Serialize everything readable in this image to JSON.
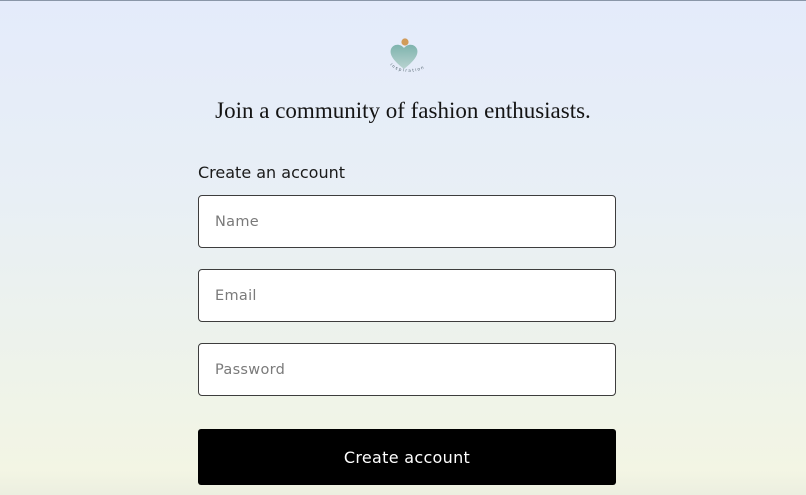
{
  "brand": {
    "logo_icon": "heart-logo-icon",
    "logo_text": "inspiration",
    "logo_colors": {
      "heart": "#8fbab5",
      "dot": "#d19c5a"
    }
  },
  "page": {
    "heading": "Join a community of fashion enthusiasts."
  },
  "form": {
    "title": "Create an account",
    "name_placeholder": "Name",
    "email_placeholder": "Email",
    "password_placeholder": "Password",
    "submit_label": "Create account"
  },
  "colors": {
    "button_background": "#000000",
    "button_text": "#ffffff",
    "field_border": "#3d3d3d"
  }
}
